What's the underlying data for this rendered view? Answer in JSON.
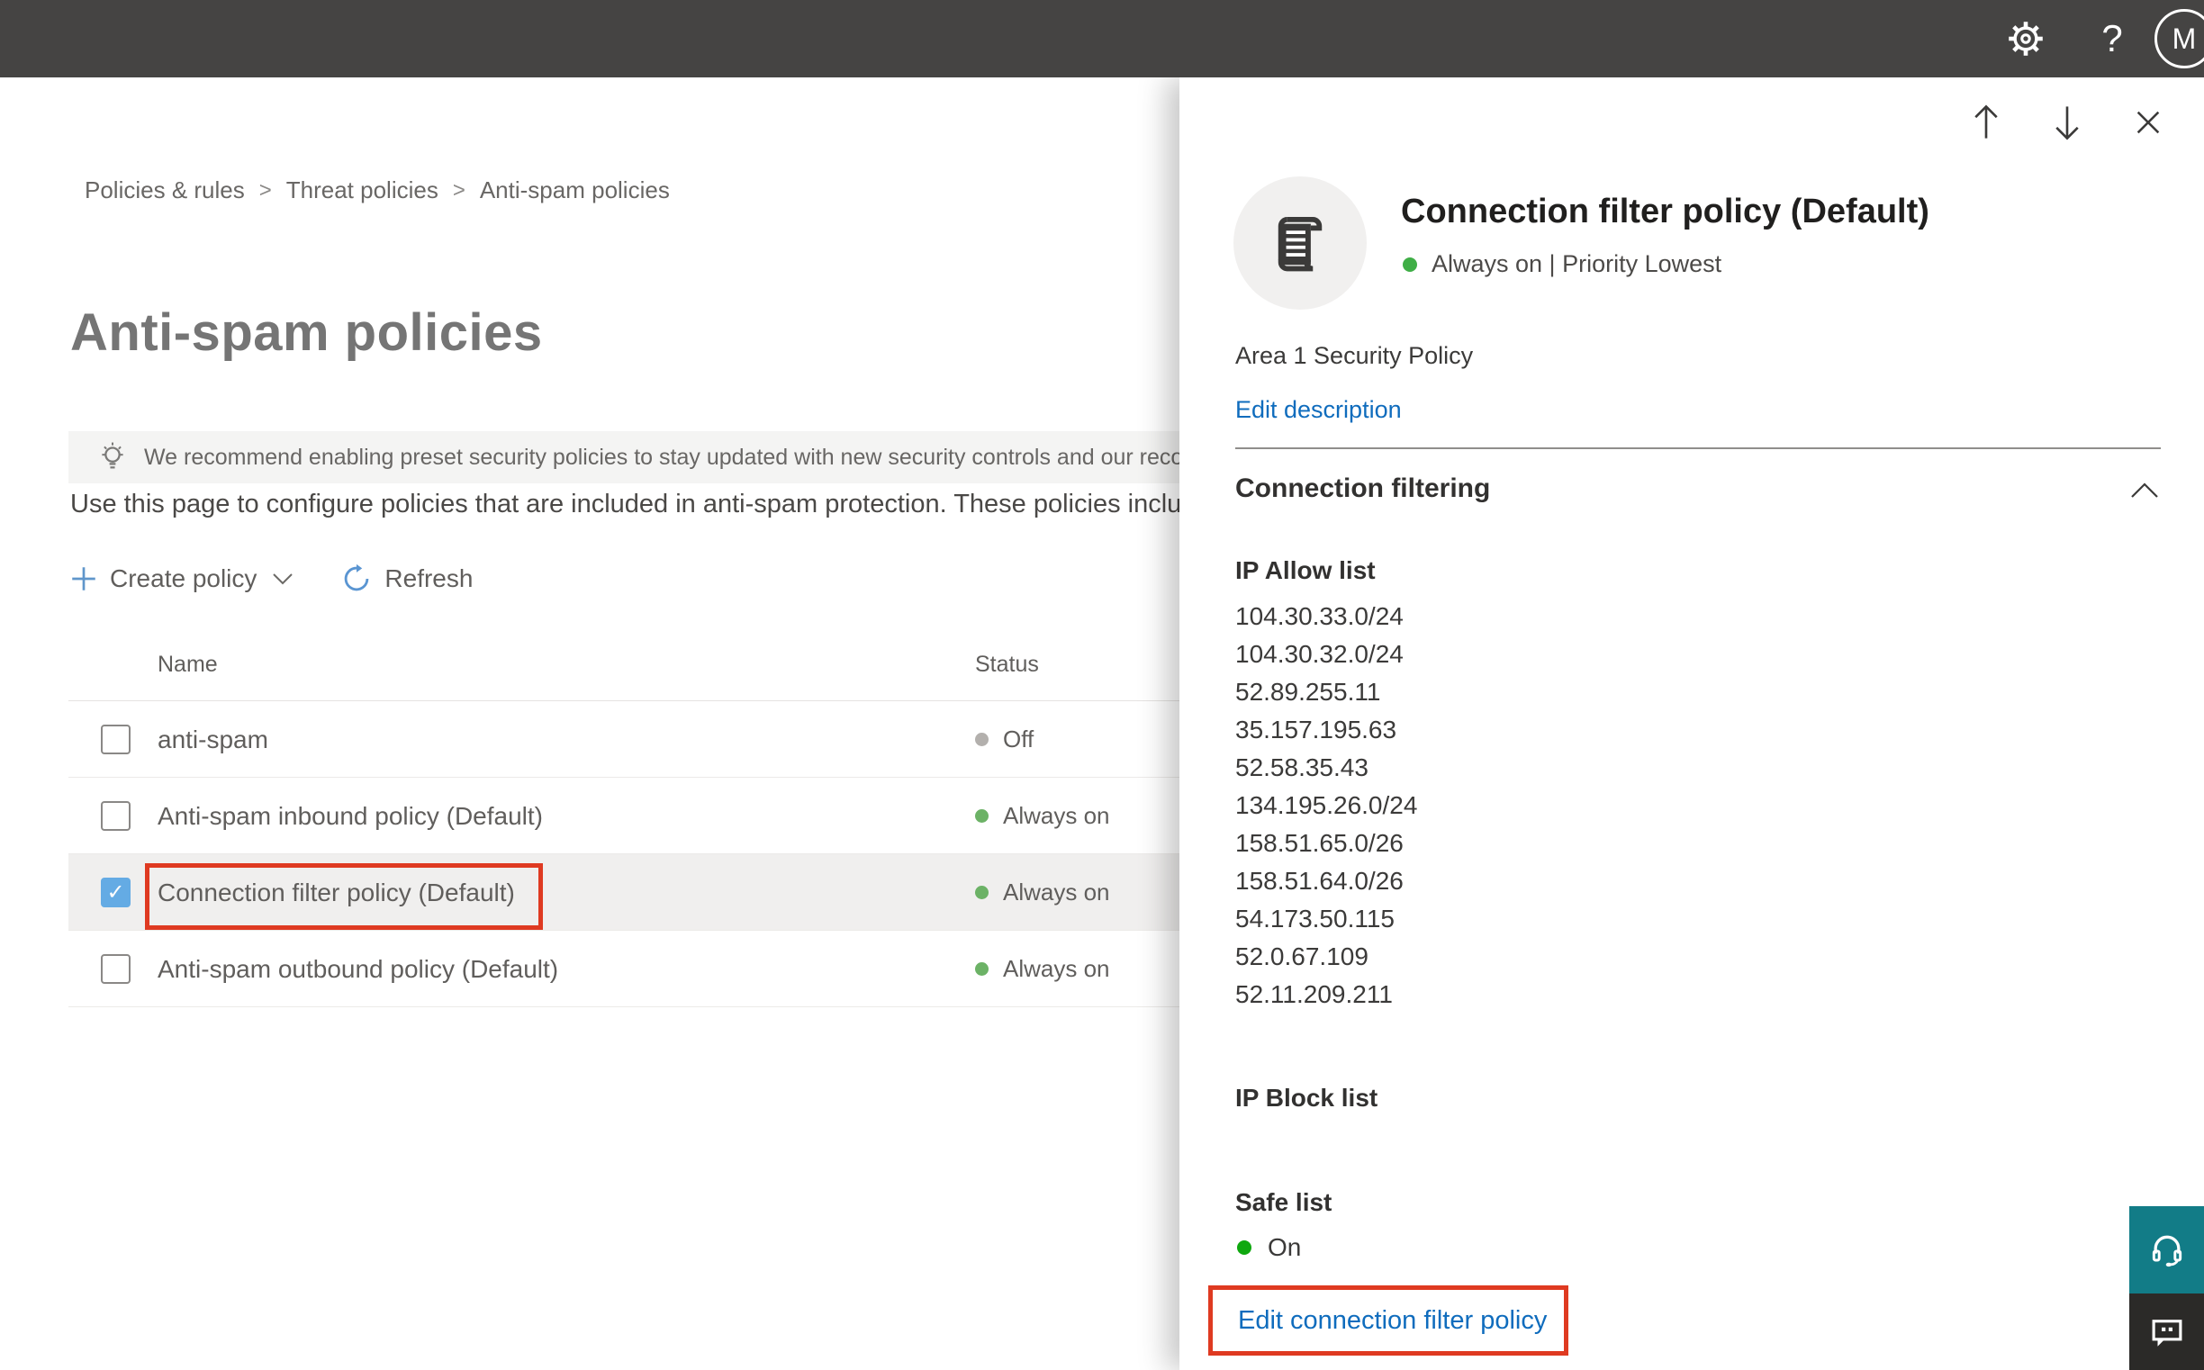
{
  "topbar": {
    "avatar_initial": "M",
    "help_glyph": "?"
  },
  "breadcrumb": {
    "items": [
      "Policies & rules",
      "Threat policies",
      "Anti-spam policies"
    ],
    "separator": ">"
  },
  "page": {
    "title": "Anti-spam policies",
    "banner_text": "We recommend enabling preset security policies to stay updated with new security controls and our recomme",
    "description": "Use this page to configure policies that are included in anti-spam protection. These policies include",
    "toolbar": {
      "create_label": "Create policy",
      "refresh_label": "Refresh"
    }
  },
  "table": {
    "columns": {
      "name": "Name",
      "status": "Status"
    },
    "rows": [
      {
        "name": "anti-spam",
        "status": "Off",
        "checked": false,
        "selected": false
      },
      {
        "name": "Anti-spam inbound policy (Default)",
        "status": "Always on",
        "checked": false,
        "selected": false
      },
      {
        "name": "Connection filter policy (Default)",
        "status": "Always on",
        "checked": true,
        "selected": true
      },
      {
        "name": "Anti-spam outbound policy (Default)",
        "status": "Always on",
        "checked": false,
        "selected": false
      }
    ]
  },
  "panel": {
    "title": "Connection filter policy (Default)",
    "status_line": "Always on | Priority Lowest",
    "description": "Area 1 Security Policy",
    "edit_description_label": "Edit description",
    "section_title": "Connection filtering",
    "ip_allow": {
      "heading": "IP Allow list",
      "items": [
        "104.30.33.0/24",
        "104.30.32.0/24",
        "52.89.255.11",
        "35.157.195.63",
        "52.58.35.43",
        "134.195.26.0/24",
        "158.51.65.0/26",
        "158.51.64.0/26",
        "54.173.50.115",
        "52.0.67.109",
        "52.11.209.211"
      ]
    },
    "ip_block": {
      "heading": "IP Block list"
    },
    "safe_list": {
      "heading": "Safe list",
      "status": "On"
    },
    "edit_link_label": "Edit connection filter policy"
  },
  "icons": {
    "check": "✓"
  },
  "colors": {
    "topbar_bg": "#454443",
    "accent_blue": "#0f6cbd",
    "annotation_red": "#df3a21",
    "status_green": "#6cb266",
    "safelist_green": "#0fa80f",
    "status_off_gray": "#b3b0ad",
    "support_teal": "#127c87",
    "feedback_dark": "#2b2a28",
    "checkbox_checked_blue": "#64abe4"
  }
}
